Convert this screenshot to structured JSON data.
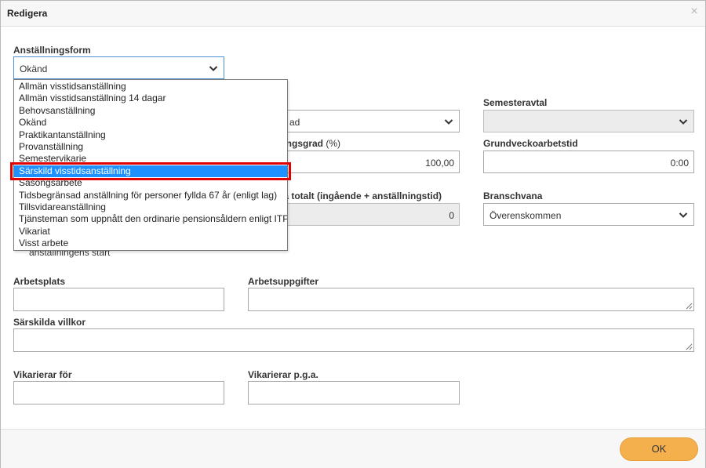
{
  "dialog": {
    "title": "Redigera",
    "close_symbol": "×"
  },
  "fields": {
    "anstallningsform": {
      "label": "Anställningsform",
      "value": "Okänd"
    },
    "hidden_select": {
      "value": "ad"
    },
    "semesteravtal": {
      "label": "Semesteravtal",
      "value": ""
    },
    "anstallningsgrad": {
      "label_bold": "ningsgrad",
      "label_suffix": " (%)",
      "value": "100,00"
    },
    "grundveckoarbetstid": {
      "label": "Grundveckoarbetstid",
      "value": "0:00"
    },
    "vana_totalt": {
      "label": "na totalt (ingående + anställningstid)",
      "value": "0"
    },
    "branschvana": {
      "label": "Branschvana",
      "value": "Överenskommen"
    },
    "start_note": "anställningens start",
    "arbetsplats": {
      "label": "Arbetsplats",
      "value": ""
    },
    "arbetsuppgifter": {
      "label": "Arbetsuppgifter",
      "value": ""
    },
    "sarskilda_villkor": {
      "label": "Särskilda villkor",
      "value": ""
    },
    "vikarierar_for": {
      "label": "Vikarierar för",
      "value": ""
    },
    "vikarierar_pga": {
      "label": "Vikarierar p.g.a.",
      "value": ""
    }
  },
  "dropdown": {
    "options": [
      "Allmän visstidsanställning",
      "Allmän visstidsanställning 14 dagar",
      "Behovsanställning",
      "Okänd",
      "Praktikantanställning",
      "Provanställning",
      "Semestervikarie",
      "Särskild visstidsanställning",
      "Säsongsarbete",
      "Tidsbegränsad anställning för personer fyllda 67 år (enligt lag)",
      "Tillsvidareanställning",
      "Tjänsteman som uppnått den ordinarie pensionsåldern enligt ITP-planen",
      "Vikariat",
      "Visst arbete"
    ],
    "selected_index": 7
  },
  "footer": {
    "ok_label": "OK"
  },
  "colors": {
    "selected_option": "#1e90ff",
    "highlight_border": "#e00000",
    "ok_button": "#f5b04e"
  }
}
